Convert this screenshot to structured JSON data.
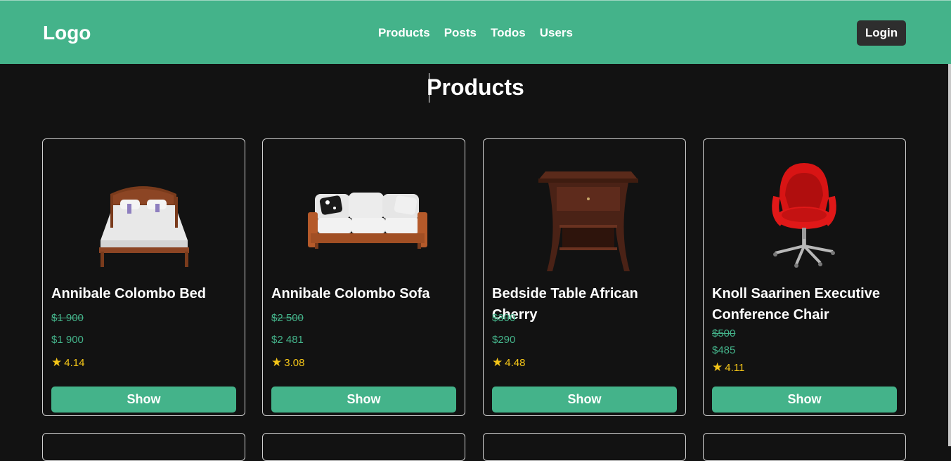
{
  "header": {
    "logo": "Logo",
    "nav": [
      "Products",
      "Posts",
      "Todos",
      "Users"
    ],
    "login_label": "Login"
  },
  "page_title": "Products",
  "colors": {
    "accent": "#44b38a",
    "background": "#121212",
    "rating": "#f4c518",
    "login_button": "#2e2e2e"
  },
  "products": [
    {
      "title": "Annibale Colombo Bed",
      "old_price": "$1 900",
      "price": "$1 900",
      "rating": "4.14",
      "button": "Show",
      "image": "bed-image"
    },
    {
      "title": "Annibale Colombo Sofa",
      "old_price": "$2 500",
      "price": "$2 481",
      "rating": "3.08",
      "button": "Show",
      "image": "sofa-image"
    },
    {
      "title": "Bedside Table African Cherry",
      "old_price": "$300",
      "price": "$290",
      "rating": "4.48",
      "button": "Show",
      "image": "bedside-table-image"
    },
    {
      "title": "Knoll Saarinen Executive Conference Chair",
      "old_price": "$500",
      "price": "$485",
      "rating": "4.11",
      "button": "Show",
      "image": "chair-image"
    }
  ]
}
